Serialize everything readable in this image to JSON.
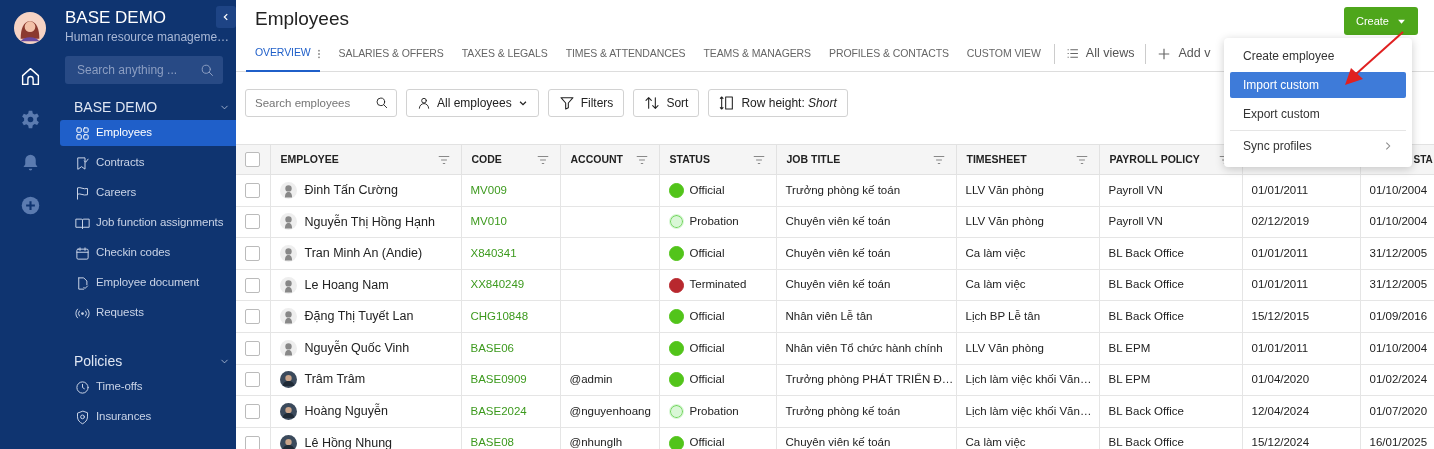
{
  "sidebar": {
    "title": "BASE DEMO",
    "subtitle": "Human resource manageme…",
    "search": {
      "placeholder": "Search anything ..."
    },
    "rail": [
      {
        "kind": "home",
        "selected": true
      },
      {
        "kind": "gear",
        "selected": false
      },
      {
        "kind": "bell",
        "selected": false
      },
      {
        "kind": "plus",
        "selected": false
      }
    ],
    "sections": [
      {
        "title": "BASE DEMO",
        "items": [
          {
            "label": "Employees",
            "kind": "grid",
            "selected": true
          },
          {
            "label": "Contracts",
            "kind": "bookmark",
            "selected": false
          },
          {
            "label": "Careers",
            "kind": "flag",
            "selected": false
          },
          {
            "label": "Job function assignments",
            "kind": "book",
            "selected": false
          },
          {
            "label": "Checkin codes",
            "kind": "calendar",
            "selected": false
          },
          {
            "label": "Employee document",
            "kind": "document",
            "selected": false
          },
          {
            "label": "Requests",
            "kind": "signal",
            "selected": false
          }
        ]
      },
      {
        "title": "Policies",
        "items": [
          {
            "label": "Time-offs",
            "kind": "clock",
            "selected": false
          },
          {
            "label": "Insurances",
            "kind": "shield",
            "selected": false
          }
        ]
      }
    ]
  },
  "page_title": "Employees",
  "create_button": "Create",
  "tabs": [
    {
      "label": "OVERVIEW",
      "selected": true
    },
    {
      "label": "SALARIES & OFFERS",
      "selected": false
    },
    {
      "label": "TAXES & LEGALS",
      "selected": false
    },
    {
      "label": "TIMES & ATTENDANCES",
      "selected": false
    },
    {
      "label": "TEAMS & MANAGERS",
      "selected": false
    },
    {
      "label": "PROFILES & CONTACTS",
      "selected": false
    },
    {
      "label": "CUSTOM VIEW",
      "selected": false
    }
  ],
  "all_views": "All views",
  "add_view": "Add v",
  "toolbar": {
    "search": {
      "placeholder": "Search employees"
    },
    "group": "All employees",
    "filters": "Filters",
    "sort": "Sort",
    "row_height": "Row height: *Short*"
  },
  "create_menu": [
    {
      "label": "Create employee",
      "selected": false,
      "submenu": false
    },
    {
      "label": "Import custom",
      "selected": true,
      "submenu": false
    },
    {
      "label": "Export custom",
      "selected": false,
      "submenu": false
    },
    {
      "label": "Sync profiles",
      "selected": false,
      "submenu": true
    }
  ],
  "table": {
    "select_all": {
      "checked": false
    },
    "columns": [
      {
        "label": "EMPLOYEE",
        "filter": true
      },
      {
        "label": "CODE",
        "filter": true
      },
      {
        "label": "ACCOUNT",
        "filter": true
      },
      {
        "label": "STATUS",
        "filter": true
      },
      {
        "label": "JOB TITLE",
        "filter": true
      },
      {
        "label": "TIMESHEET",
        "filter": true
      },
      {
        "label": "PAYROLL POLICY",
        "filter": true
      },
      {
        "filter": false
      },
      {
        "label": "STA",
        "filter": false
      }
    ],
    "rows": [
      {
        "checked": false,
        "avatar": {
          "kind": "default"
        },
        "name": "Đinh Tấn Cường",
        "code": "MV009",
        "account": "",
        "status": {
          "label": "Official",
          "color": "#52c41a"
        },
        "job_title": "Trưởng phòng kế toán",
        "timesheet": "LLV Văn phòng",
        "payroll": "Payroll VN",
        "column_8": "01/01/2011",
        "column_9": "01/10/2004"
      },
      {
        "checked": false,
        "avatar": {
          "kind": "default"
        },
        "name": "Nguyễn Thị Hồng Hạnh",
        "code": "MV010",
        "account": "",
        "status": {
          "label": "Probation",
          "color": "#d9f7d6"
        },
        "job_title": "Chuyên viên kế toán",
        "timesheet": "LLV Văn phòng",
        "payroll": "Payroll VN",
        "column_8": "02/12/2019",
        "column_9": "01/10/2004"
      },
      {
        "checked": false,
        "avatar": {
          "kind": "default"
        },
        "name": "Tran Minh An (Andie)",
        "code": "X840341",
        "account": "",
        "status": {
          "label": "Official",
          "color": "#52c41a"
        },
        "job_title": "Chuyên viên kế toán",
        "timesheet": "Ca làm việc",
        "payroll": "BL Back Office",
        "column_8": "01/01/2011",
        "column_9": "31/12/2005"
      },
      {
        "checked": false,
        "avatar": {
          "kind": "default"
        },
        "name": "Le Hoang Nam",
        "code": "XX840249",
        "account": "",
        "status": {
          "label": "Terminated",
          "color": "#b8282e"
        },
        "job_title": "Chuyên viên kế toán",
        "timesheet": "Ca làm việc",
        "payroll": "BL Back Office",
        "column_8": "01/01/2011",
        "column_9": "31/12/2005"
      },
      {
        "checked": false,
        "avatar": {
          "kind": "default"
        },
        "name": "Đặng Thị Tuyết Lan",
        "code": "CHG10848",
        "account": "",
        "status": {
          "label": "Official",
          "color": "#52c41a"
        },
        "job_title": "Nhân viên Lễ tân",
        "timesheet": "Lịch BP Lễ tân",
        "payroll": "BL Back Office",
        "column_8": "15/12/2015",
        "column_9": "01/09/2016"
      },
      {
        "checked": false,
        "avatar": {
          "kind": "default"
        },
        "name": "Nguyễn Quốc Vinh",
        "code": "BASE06",
        "account": "",
        "status": {
          "label": "Official",
          "color": "#52c41a"
        },
        "job_title": "Nhân viên Tổ chức hành chính",
        "timesheet": "LLV Văn phòng",
        "payroll": "BL EPM",
        "column_8": "01/01/2011",
        "column_9": "01/10/2004"
      },
      {
        "checked": false,
        "avatar": {
          "kind": "photo"
        },
        "name": "Trâm Trâm",
        "code": "BASE0909",
        "account": "@admin",
        "status": {
          "label": "Official",
          "color": "#52c41a"
        },
        "job_title": "Trưởng phòng PHÁT TRIỂN Đ…",
        "timesheet": "Lịch làm việc khối Văn…",
        "payroll": "BL EPM",
        "column_8": "01/04/2020",
        "column_9": "01/02/2024"
      },
      {
        "checked": false,
        "avatar": {
          "kind": "photo"
        },
        "name": "Hoàng Nguyễn",
        "code": "BASE2024",
        "account": "@nguyenhoang",
        "status": {
          "label": "Probation",
          "color": "#d9f7d6"
        },
        "job_title": "Trưởng phòng kế toán",
        "timesheet": "Lịch làm việc khối Văn…",
        "payroll": "BL Back Office",
        "column_8": "12/04/2024",
        "column_9": "01/07/2020"
      },
      {
        "checked": false,
        "avatar": {
          "kind": "photo"
        },
        "name": "Lê Hồng Nhung",
        "code": "BASE08",
        "account": "@nhunglh",
        "status": {
          "label": "Official",
          "color": "#52c41a"
        },
        "job_title": "Chuyên viên kế toán",
        "timesheet": "Ca làm việc",
        "payroll": "BL Back Office",
        "column_8": "15/12/2024",
        "column_9": "16/01/2025"
      }
    ]
  }
}
